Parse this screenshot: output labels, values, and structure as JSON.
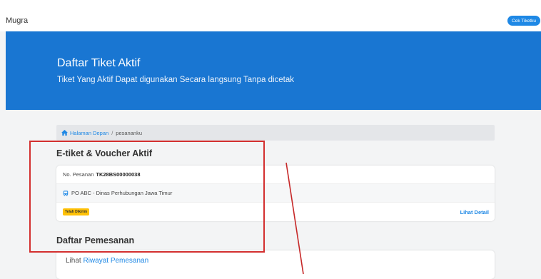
{
  "navbar": {
    "brand": "Mugra",
    "button_label": "Cek Tiketku"
  },
  "hero": {
    "title": "Daftar Tiket Aktif",
    "subtitle": "Tiket Yang Aktif Dapat digunakan Secara langsung Tanpa dicetak"
  },
  "breadcrumb": {
    "home": "Halaman Depan",
    "separator": "/",
    "current": "pesananku"
  },
  "active_section": {
    "title": "E-tiket & Voucher Aktif",
    "order_label": "No. Pesanan",
    "order_number": "TK28BS00000038",
    "operator": "PO ABC - Dinas Perhubungan Jawa Timur",
    "status_badge": "Telah Dikirim",
    "detail_link": "Lihat Detail"
  },
  "booking_section": {
    "title": "Daftar Pemesanan",
    "history_prefix": "Lihat",
    "history_link": "Riwayat Pemesanan"
  },
  "colors": {
    "primary": "#1976d2",
    "badge": "#ffc107",
    "highlight": "#d32f2f"
  },
  "icons": {
    "home": "home-icon",
    "bus": "bus-icon"
  }
}
